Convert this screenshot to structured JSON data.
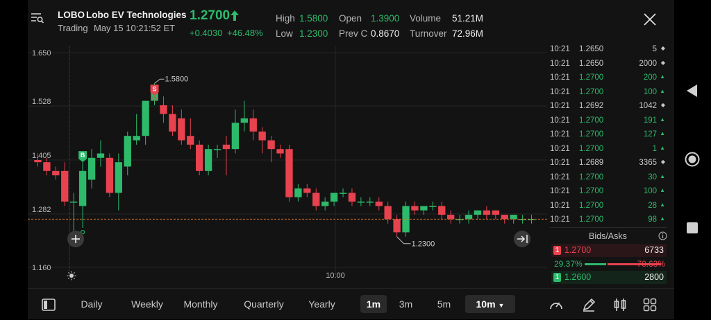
{
  "header": {
    "symbol": "LOBO",
    "name": "Lobo EV Technologies",
    "status": "Trading",
    "timestamp": "May 15 10:21:52 ET",
    "price": "1.2700",
    "change": "+0.4030",
    "change_pct": "+46.48%",
    "stats": {
      "high_label": "High",
      "high": "1.5800",
      "low_label": "Low",
      "low": "1.2300",
      "open_label": "Open",
      "open": "1.3900",
      "prevc_label": "Prev C",
      "prevc": "0.8670",
      "volume_label": "Volume",
      "volume": "51.21M",
      "turnover_label": "Turnover",
      "turnover": "72.96M"
    }
  },
  "chart": {
    "y_ticks": [
      "1.650",
      "1.528",
      "1.405",
      "1.282",
      "1.160"
    ],
    "x_tick": "10:00",
    "high_label": "1.5800",
    "low_label": "1.2300",
    "buy_marker": "B",
    "sell_marker": "S",
    "current_price": 1.27
  },
  "chart_data": {
    "type": "candlestick",
    "ylim": [
      1.16,
      1.65
    ],
    "y_ticks": [
      1.65,
      1.528,
      1.405,
      1.282,
      1.16
    ],
    "last_price": 1.27,
    "candles": [
      {
        "o": 1.405,
        "h": 1.42,
        "l": 1.39,
        "c": 1.4
      },
      {
        "o": 1.4,
        "h": 1.41,
        "l": 1.37,
        "c": 1.38
      },
      {
        "o": 1.38,
        "h": 1.39,
        "l": 1.36,
        "c": 1.37
      },
      {
        "o": 1.38,
        "h": 1.4,
        "l": 1.3,
        "c": 1.31
      },
      {
        "o": 1.31,
        "h": 1.33,
        "l": 1.24,
        "c": 1.31
      },
      {
        "o": 1.3,
        "h": 1.4,
        "l": 1.25,
        "c": 1.38
      },
      {
        "o": 1.36,
        "h": 1.43,
        "l": 1.34,
        "c": 1.41
      },
      {
        "o": 1.41,
        "h": 1.45,
        "l": 1.39,
        "c": 1.42
      },
      {
        "o": 1.41,
        "h": 1.42,
        "l": 1.32,
        "c": 1.33
      },
      {
        "o": 1.33,
        "h": 1.42,
        "l": 1.29,
        "c": 1.4
      },
      {
        "o": 1.39,
        "h": 1.47,
        "l": 1.37,
        "c": 1.46
      },
      {
        "o": 1.45,
        "h": 1.51,
        "l": 1.44,
        "c": 1.46
      },
      {
        "o": 1.46,
        "h": 1.54,
        "l": 1.44,
        "c": 1.54
      },
      {
        "o": 1.54,
        "h": 1.58,
        "l": 1.53,
        "c": 1.57
      },
      {
        "o": 1.53,
        "h": 1.55,
        "l": 1.49,
        "c": 1.51
      },
      {
        "o": 1.51,
        "h": 1.53,
        "l": 1.46,
        "c": 1.47
      },
      {
        "o": 1.5,
        "h": 1.52,
        "l": 1.44,
        "c": 1.45
      },
      {
        "o": 1.46,
        "h": 1.5,
        "l": 1.43,
        "c": 1.44
      },
      {
        "o": 1.44,
        "h": 1.45,
        "l": 1.37,
        "c": 1.38
      },
      {
        "o": 1.38,
        "h": 1.44,
        "l": 1.37,
        "c": 1.43
      },
      {
        "o": 1.43,
        "h": 1.44,
        "l": 1.41,
        "c": 1.43
      },
      {
        "o": 1.44,
        "h": 1.46,
        "l": 1.37,
        "c": 1.43
      },
      {
        "o": 1.43,
        "h": 1.52,
        "l": 1.42,
        "c": 1.49
      },
      {
        "o": 1.49,
        "h": 1.54,
        "l": 1.47,
        "c": 1.5
      },
      {
        "o": 1.5,
        "h": 1.52,
        "l": 1.45,
        "c": 1.47
      },
      {
        "o": 1.47,
        "h": 1.48,
        "l": 1.42,
        "c": 1.45
      },
      {
        "o": 1.45,
        "h": 1.46,
        "l": 1.4,
        "c": 1.43
      },
      {
        "o": 1.43,
        "h": 1.44,
        "l": 1.41,
        "c": 1.42
      },
      {
        "o": 1.43,
        "h": 1.44,
        "l": 1.31,
        "c": 1.32
      },
      {
        "o": 1.32,
        "h": 1.35,
        "l": 1.31,
        "c": 1.34
      },
      {
        "o": 1.34,
        "h": 1.35,
        "l": 1.32,
        "c": 1.33
      },
      {
        "o": 1.33,
        "h": 1.34,
        "l": 1.29,
        "c": 1.3
      },
      {
        "o": 1.3,
        "h": 1.32,
        "l": 1.29,
        "c": 1.31
      },
      {
        "o": 1.31,
        "h": 1.33,
        "l": 1.3,
        "c": 1.33
      },
      {
        "o": 1.33,
        "h": 1.34,
        "l": 1.32,
        "c": 1.33
      },
      {
        "o": 1.33,
        "h": 1.34,
        "l": 1.3,
        "c": 1.31
      },
      {
        "o": 1.31,
        "h": 1.32,
        "l": 1.3,
        "c": 1.31
      },
      {
        "o": 1.31,
        "h": 1.32,
        "l": 1.3,
        "c": 1.31
      },
      {
        "o": 1.31,
        "h": 1.32,
        "l": 1.29,
        "c": 1.3
      },
      {
        "o": 1.3,
        "h": 1.31,
        "l": 1.26,
        "c": 1.27
      },
      {
        "o": 1.27,
        "h": 1.28,
        "l": 1.23,
        "c": 1.24
      },
      {
        "o": 1.24,
        "h": 1.31,
        "l": 1.23,
        "c": 1.3
      },
      {
        "o": 1.3,
        "h": 1.31,
        "l": 1.28,
        "c": 1.29
      },
      {
        "o": 1.29,
        "h": 1.3,
        "l": 1.28,
        "c": 1.3
      },
      {
        "o": 1.3,
        "h": 1.31,
        "l": 1.29,
        "c": 1.3
      },
      {
        "o": 1.3,
        "h": 1.31,
        "l": 1.27,
        "c": 1.28
      },
      {
        "o": 1.28,
        "h": 1.29,
        "l": 1.26,
        "c": 1.27
      },
      {
        "o": 1.27,
        "h": 1.28,
        "l": 1.26,
        "c": 1.27
      },
      {
        "o": 1.27,
        "h": 1.29,
        "l": 1.26,
        "c": 1.28
      },
      {
        "o": 1.28,
        "h": 1.29,
        "l": 1.27,
        "c": 1.29
      },
      {
        "o": 1.29,
        "h": 1.3,
        "l": 1.27,
        "c": 1.28
      },
      {
        "o": 1.29,
        "h": 1.29,
        "l": 1.27,
        "c": 1.28
      },
      {
        "o": 1.28,
        "h": 1.28,
        "l": 1.26,
        "c": 1.27
      },
      {
        "o": 1.27,
        "h": 1.28,
        "l": 1.26,
        "c": 1.28
      },
      {
        "o": 1.27,
        "h": 1.28,
        "l": 1.26,
        "c": 1.27
      },
      {
        "o": 1.27,
        "h": 1.28,
        "l": 1.26,
        "c": 1.27
      }
    ]
  },
  "tape": [
    {
      "time": "10:21",
      "price": "1.2650",
      "vol": "5",
      "dir": "neutral"
    },
    {
      "time": "10:21",
      "price": "1.2650",
      "vol": "2000",
      "dir": "neutral"
    },
    {
      "time": "10:21",
      "price": "1.2700",
      "vol": "200",
      "dir": "up"
    },
    {
      "time": "10:21",
      "price": "1.2700",
      "vol": "100",
      "dir": "up"
    },
    {
      "time": "10:21",
      "price": "1.2692",
      "vol": "1042",
      "dir": "neutral"
    },
    {
      "time": "10:21",
      "price": "1.2700",
      "vol": "191",
      "dir": "up"
    },
    {
      "time": "10:21",
      "price": "1.2700",
      "vol": "127",
      "dir": "up"
    },
    {
      "time": "10:21",
      "price": "1.2700",
      "vol": "1",
      "dir": "up"
    },
    {
      "time": "10:21",
      "price": "1.2689",
      "vol": "3365",
      "dir": "neutral"
    },
    {
      "time": "10:21",
      "price": "1.2700",
      "vol": "30",
      "dir": "up"
    },
    {
      "time": "10:21",
      "price": "1.2700",
      "vol": "100",
      "dir": "up"
    },
    {
      "time": "10:21",
      "price": "1.2700",
      "vol": "28",
      "dir": "up"
    },
    {
      "time": "10:21",
      "price": "1.2700",
      "vol": "98",
      "dir": "up"
    }
  ],
  "bids_asks": {
    "title": "Bids/Asks",
    "ask_level": "1",
    "ask_price": "1.2700",
    "ask_size": "6733",
    "bid_pct": "29.37%",
    "ask_pct": "70.63%",
    "bid_ratio": 0.2937,
    "bid_level": "1",
    "bid_price": "1.2600",
    "bid_size": "2800"
  },
  "timeframes": {
    "items": [
      "Daily",
      "Weekly",
      "Monthly",
      "Quarterly",
      "Yearly",
      "1m",
      "3m",
      "5m",
      "10m"
    ],
    "active": "1m",
    "selected_dropdown": "10m"
  },
  "colors": {
    "up": "#2dba6b",
    "down": "#e8424f",
    "bg": "#131313"
  }
}
